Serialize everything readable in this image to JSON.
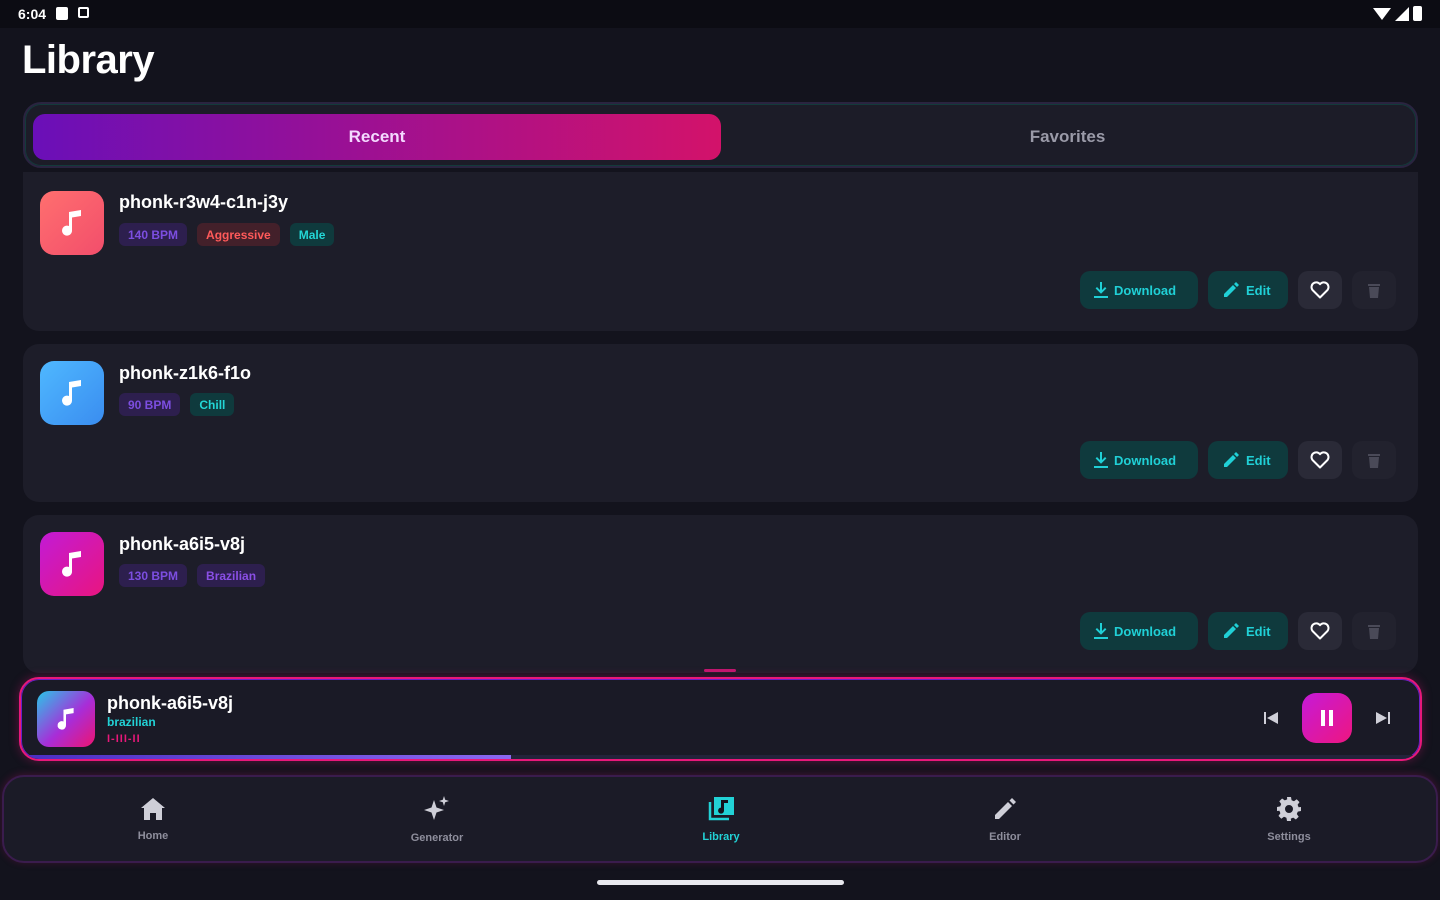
{
  "status_bar": {
    "time": "6:04"
  },
  "page": {
    "title": "Library"
  },
  "tabs": [
    {
      "label": "Recent",
      "active": true
    },
    {
      "label": "Favorites",
      "active": false
    }
  ],
  "actions": {
    "download_label": "Download",
    "edit_label": "Edit"
  },
  "tracks": [
    {
      "name": "phonk-r3w4-c1n-j3y",
      "tags": [
        "140 BPM",
        "Aggressive",
        "Male"
      ]
    },
    {
      "name": "phonk-z1k6-f1o",
      "tags": [
        "90 BPM",
        "Chill"
      ]
    },
    {
      "name": "phonk-a6i5-v8j",
      "tags": [
        "130 BPM",
        "Brazilian"
      ]
    }
  ],
  "player": {
    "title": "phonk-a6i5-v8j",
    "subtitle": "brazilian",
    "wave_text": "I-III-II",
    "progress": 0.35,
    "state": "playing"
  },
  "nav": [
    {
      "label": "Home",
      "icon": "home-icon"
    },
    {
      "label": "Generator",
      "icon": "sparkle-icon"
    },
    {
      "label": "Library",
      "icon": "library-icon",
      "active": true
    },
    {
      "label": "Editor",
      "icon": "pencil-icon"
    },
    {
      "label": "Settings",
      "icon": "gear-icon"
    }
  ],
  "colors": {
    "accent_teal": "#22d2d6",
    "accent_pink": "#e8187a",
    "accent_purple": "#6a0fb8",
    "background": "#13131d",
    "card": "#1d1d29"
  }
}
